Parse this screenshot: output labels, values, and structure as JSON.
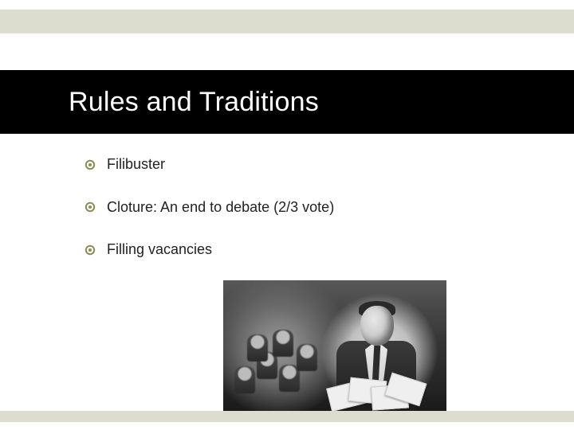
{
  "title": "Rules and Traditions",
  "bullets": [
    {
      "text": "Filibuster"
    },
    {
      "text": "Cloture: An end to debate (2/3 vote)"
    },
    {
      "text": "Filling vacancies"
    }
  ],
  "colors": {
    "band": "#dcdccf",
    "title_bg": "#000000",
    "title_fg": "#ffffff",
    "bullet_ring": "#8c8c55"
  },
  "image": {
    "semantic": "filibuster-photo",
    "description": "Black-and-white still of a man in a suit holding papers, crowd seated behind"
  }
}
